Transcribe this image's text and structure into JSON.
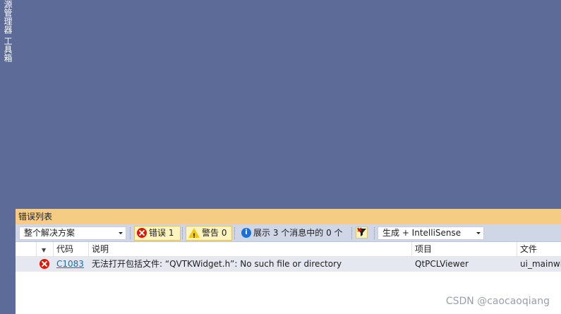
{
  "sidebar": {
    "tabs": [
      {
        "label": "资源管理器"
      },
      {
        "label": "工具箱"
      }
    ]
  },
  "error_list": {
    "title": "错误列表",
    "scope_combo": "整个解决方案",
    "errors_button": "错误 1",
    "warnings_button": "警告 0",
    "messages_button": "展示 3 个消息中的 0 个",
    "source_combo": "生成 + IntelliSense",
    "columns": {
      "code": "代码",
      "description": "说明",
      "project": "项目",
      "file": "文件"
    },
    "rows": [
      {
        "severity": "error",
        "code": "C1083",
        "description": "无法打开包括文件: “QVTKWidget.h”: No such file or directory",
        "project": "QtPCLViewer",
        "file": "ui_mainwindow.h"
      }
    ]
  },
  "watermark": "CSDN @caocaoqiang",
  "colors": {
    "background": "#5d6b99",
    "panel_title": "#f5cc84",
    "toolbar": "#cfd6e5",
    "error": "#e51400",
    "warning": "#f2c811",
    "info": "#1c6fd4",
    "link": "#0e70c0"
  }
}
